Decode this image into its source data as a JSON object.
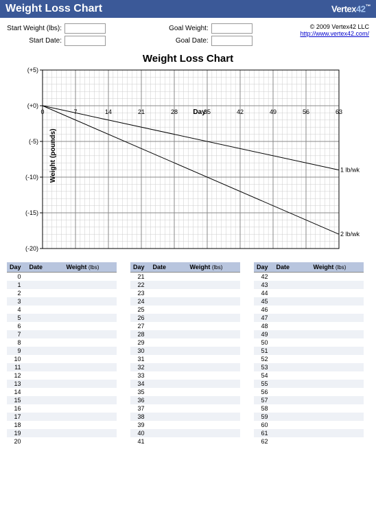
{
  "titlebar": {
    "title": "Weight Loss Chart",
    "logo_text": "Vertex",
    "logo_num": "42"
  },
  "header": {
    "start_weight_label": "Start Weight (lbs):",
    "start_date_label": "Start Date:",
    "goal_weight_label": "Goal Weight:",
    "goal_date_label": "Goal Date:",
    "start_weight_value": "",
    "start_date_value": "",
    "goal_weight_value": "",
    "goal_date_value": "",
    "copyright": "© 2009 Vertex42 LLC",
    "link_text": "http://www.vertex42.com/"
  },
  "chart_data": {
    "type": "line",
    "title": "Weight Loss Chart",
    "xlabel": "Day",
    "ylabel": "Weight (pounds)",
    "xlim": [
      0,
      63
    ],
    "ylim": [
      -20,
      5
    ],
    "xticks": [
      0,
      7,
      14,
      21,
      28,
      35,
      42,
      49,
      56,
      63
    ],
    "yticks": [
      5,
      0,
      -5,
      -10,
      -15,
      -20
    ],
    "ytick_labels": [
      "(+5)",
      "(+0)",
      "(-5)",
      "(-10)",
      "(-15)",
      "(-20)"
    ],
    "series": [
      {
        "name": "1 lb/wk",
        "x": [
          0,
          63
        ],
        "y": [
          0,
          -9
        ]
      },
      {
        "name": "2 lb/wk",
        "x": [
          0,
          63
        ],
        "y": [
          0,
          -18
        ]
      }
    ]
  },
  "log": {
    "headers": {
      "day": "Day",
      "date": "Date",
      "weight": "Weight",
      "weight_unit": "(lbs)"
    },
    "columns": [
      [
        0,
        1,
        2,
        3,
        4,
        5,
        6,
        7,
        8,
        9,
        10,
        11,
        12,
        13,
        14,
        15,
        16,
        17,
        18,
        19,
        20
      ],
      [
        21,
        22,
        23,
        24,
        25,
        26,
        27,
        28,
        29,
        30,
        31,
        32,
        33,
        34,
        35,
        36,
        37,
        38,
        39,
        40,
        41
      ],
      [
        42,
        43,
        44,
        45,
        46,
        47,
        48,
        49,
        50,
        51,
        52,
        53,
        54,
        55,
        56,
        57,
        58,
        59,
        60,
        61,
        62
      ]
    ]
  }
}
